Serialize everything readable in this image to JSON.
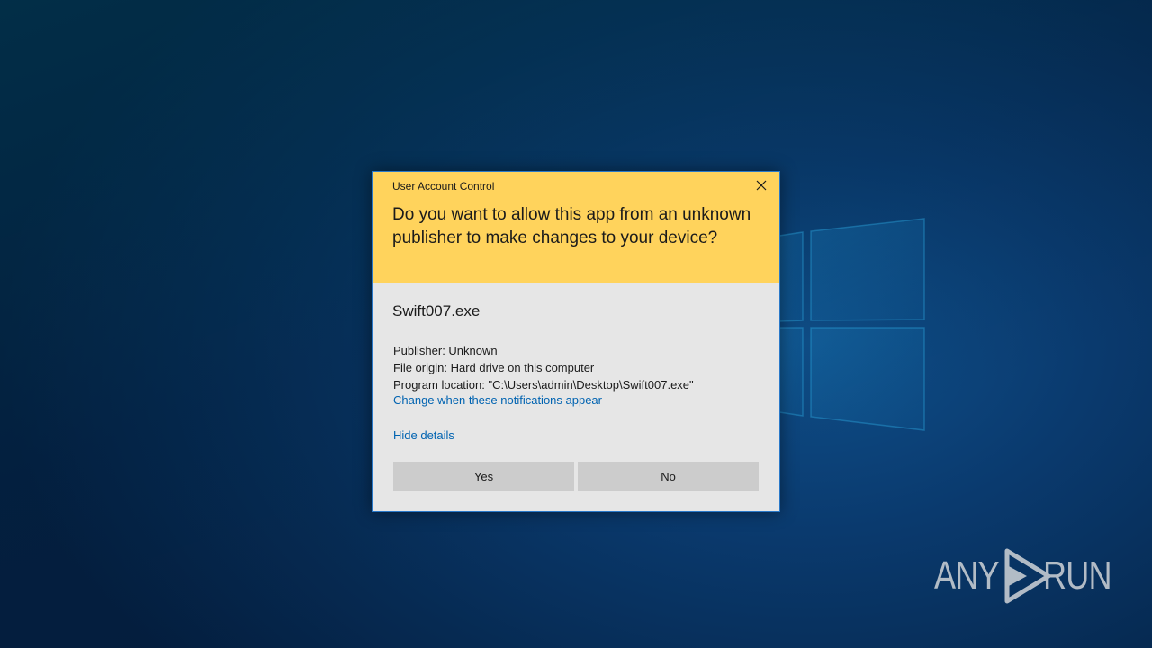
{
  "dialog": {
    "title": "User Account Control",
    "question": "Do you want to allow this app from an unknown publisher to make changes to your device?",
    "app_name": "Swift007.exe",
    "publisher": "Publisher: Unknown",
    "file_origin": "File origin: Hard drive on this computer",
    "program_location": "Program location: \"C:\\Users\\admin\\Desktop\\Swift007.exe\"",
    "change_link": "Change when these notifications appear",
    "hide_details": "Hide details",
    "yes_label": "Yes",
    "no_label": "No",
    "close_icon": "close-icon",
    "header_color": "#ffd35c",
    "body_color": "#e6e6e6",
    "link_color": "#0063b1"
  },
  "watermark": {
    "left_text": "ANY",
    "right_text": "RUN",
    "icon": "play-logo-icon"
  }
}
